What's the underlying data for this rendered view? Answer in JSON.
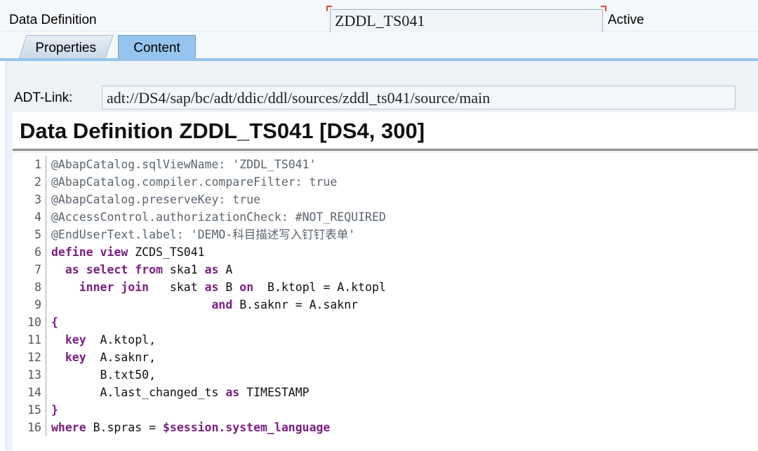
{
  "header": {
    "object_type_label": "Data Definition",
    "object_name": "ZDDL_TS041",
    "status": "Active"
  },
  "tabs": [
    {
      "label": "Properties",
      "active": false
    },
    {
      "label": "Content",
      "active": true
    }
  ],
  "adt_link": {
    "label": "ADT-Link:",
    "value": "adt://DS4/sap/bc/adt/ddic/ddl/sources/zddl_ts041/source/main"
  },
  "editor": {
    "title": "Data Definition ZDDL_TS041 [DS4, 300]",
    "lines": [
      {
        "no": "1",
        "tokens": [
          {
            "t": "@AbapCatalog.sqlViewName: 'ZDDL_TS041'",
            "c": "ann"
          }
        ]
      },
      {
        "no": "2",
        "tokens": [
          {
            "t": "@AbapCatalog.compiler.compareFilter: true",
            "c": "ann"
          }
        ]
      },
      {
        "no": "3",
        "tokens": [
          {
            "t": "@AbapCatalog.preserveKey: true",
            "c": "ann"
          }
        ]
      },
      {
        "no": "4",
        "tokens": [
          {
            "t": "@AccessControl.authorizationCheck: #NOT_REQUIRED",
            "c": "ann"
          }
        ]
      },
      {
        "no": "5",
        "tokens": [
          {
            "t": "@EndUserText.label: 'DEMO-科目描述写入钉钉表单'",
            "c": "ann"
          }
        ]
      },
      {
        "no": "6",
        "tokens": [
          {
            "t": "define",
            "c": "kw"
          },
          {
            "t": " ",
            "c": "pl"
          },
          {
            "t": "view",
            "c": "kw"
          },
          {
            "t": " ZCDS_TS041",
            "c": "pl"
          }
        ]
      },
      {
        "no": "7",
        "tokens": [
          {
            "t": "  ",
            "c": "pl"
          },
          {
            "t": "as",
            "c": "kw"
          },
          {
            "t": " ",
            "c": "pl"
          },
          {
            "t": "select",
            "c": "kw"
          },
          {
            "t": " ",
            "c": "pl"
          },
          {
            "t": "from",
            "c": "kw"
          },
          {
            "t": " ska1 ",
            "c": "pl"
          },
          {
            "t": "as",
            "c": "kw"
          },
          {
            "t": " A",
            "c": "pl"
          }
        ]
      },
      {
        "no": "8",
        "tokens": [
          {
            "t": "    ",
            "c": "pl"
          },
          {
            "t": "inner",
            "c": "kw"
          },
          {
            "t": " ",
            "c": "pl"
          },
          {
            "t": "join",
            "c": "kw"
          },
          {
            "t": "   skat ",
            "c": "pl"
          },
          {
            "t": "as",
            "c": "kw"
          },
          {
            "t": " B ",
            "c": "pl"
          },
          {
            "t": "on",
            "c": "kw"
          },
          {
            "t": "  B.ktopl = A.ktopl",
            "c": "pl"
          }
        ]
      },
      {
        "no": "9",
        "tokens": [
          {
            "t": "                       ",
            "c": "pl"
          },
          {
            "t": "and",
            "c": "kw"
          },
          {
            "t": " B.saknr = A.saknr",
            "c": "pl"
          }
        ]
      },
      {
        "no": "10",
        "tokens": [
          {
            "t": "{",
            "c": "br"
          }
        ]
      },
      {
        "no": "11",
        "tokens": [
          {
            "t": "  ",
            "c": "pl"
          },
          {
            "t": "key",
            "c": "kw"
          },
          {
            "t": "  A.ktopl,",
            "c": "pl"
          }
        ]
      },
      {
        "no": "12",
        "tokens": [
          {
            "t": "  ",
            "c": "pl"
          },
          {
            "t": "key",
            "c": "kw"
          },
          {
            "t": "  A.saknr,",
            "c": "pl"
          }
        ]
      },
      {
        "no": "13",
        "tokens": [
          {
            "t": "       B.txt50,",
            "c": "pl"
          }
        ]
      },
      {
        "no": "14",
        "tokens": [
          {
            "t": "       A.last_changed_ts ",
            "c": "pl"
          },
          {
            "t": "as",
            "c": "kw"
          },
          {
            "t": " TIMESTAMP",
            "c": "pl"
          }
        ]
      },
      {
        "no": "15",
        "tokens": [
          {
            "t": "}",
            "c": "br"
          }
        ]
      },
      {
        "no": "16",
        "tokens": [
          {
            "t": "where",
            "c": "kw"
          },
          {
            "t": " B.spras = ",
            "c": "pl"
          },
          {
            "t": "$session.system_language",
            "c": "kw"
          }
        ]
      }
    ]
  }
}
